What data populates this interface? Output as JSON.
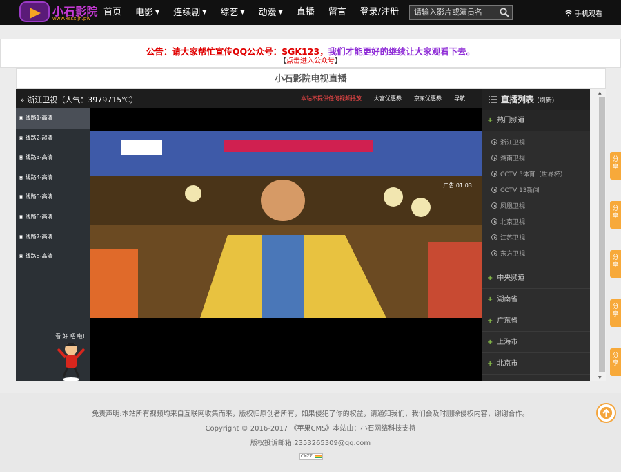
{
  "header": {
    "logo_text": "小石影院",
    "logo_url": "www.xssxljh.pw",
    "nav": [
      {
        "label": "首页",
        "dropdown": false
      },
      {
        "label": "电影",
        "dropdown": true
      },
      {
        "label": "连续剧",
        "dropdown": true
      },
      {
        "label": "综艺",
        "dropdown": true
      },
      {
        "label": "动漫",
        "dropdown": true
      },
      {
        "label": "直播",
        "dropdown": false
      },
      {
        "label": "留言",
        "dropdown": false
      },
      {
        "label": "登录/注册",
        "dropdown": false
      }
    ],
    "search_placeholder": "请输入影片或演员名",
    "mobile_label": "手机观看"
  },
  "notice": {
    "red_text": "公告：请大家帮忙宣传QQ公众号：SGK123，",
    "purple_text": "我们才能更好的继续让大家观看下去。",
    "link_open": "【",
    "link_text": "点击进入公众号",
    "link_close": "】"
  },
  "page_title": "小石影院电视直播",
  "player": {
    "channel_title": "» 浙江卫视（人气：3979715℃）",
    "head_links": [
      "本站不提供任何视频播放",
      "大富优惠券",
      "京东优惠券",
      "导航"
    ],
    "lines": [
      "线路1-高清",
      "线路2-超清",
      "线路3-高清",
      "线路4-高清",
      "线路5-高清",
      "线路6-高清",
      "线路7-高清",
      "线路8-高清"
    ],
    "ad_timer": "广告 01:03"
  },
  "sidebar": {
    "title": "直播列表",
    "refresh": "(刷新)",
    "open_group": "热门频道",
    "open_channels": [
      "浙江卫视",
      "湖南卫视",
      "CCTV 5体育（世界杯）",
      "CCTV 13新闻",
      "凤凰卫视",
      "北京卫视",
      "江苏卫视",
      "东方卫视"
    ],
    "groups": [
      "中央频道",
      "湖南省",
      "广东省",
      "上海市",
      "北京市",
      "湖北省"
    ]
  },
  "share_label": "分享",
  "footer": {
    "disclaimer": "免责声明:本站所有视频均来自互联网收集而来，版权归原创者所有，如果侵犯了你的权益，请通知我们，我们会及时删除侵权内容，谢谢合作。",
    "copyright": "Copyright © 2016-2017 《苹果CMS》本站由：小石网络科技支持",
    "email": "版权投诉邮箱:2353265309@qq.com",
    "badge": "CNZZ"
  },
  "colors": {
    "accent_orange": "#f7a93a",
    "notice_red": "#e00000",
    "notice_purple": "#8e2bd6",
    "live_green": "#8bc34a"
  }
}
